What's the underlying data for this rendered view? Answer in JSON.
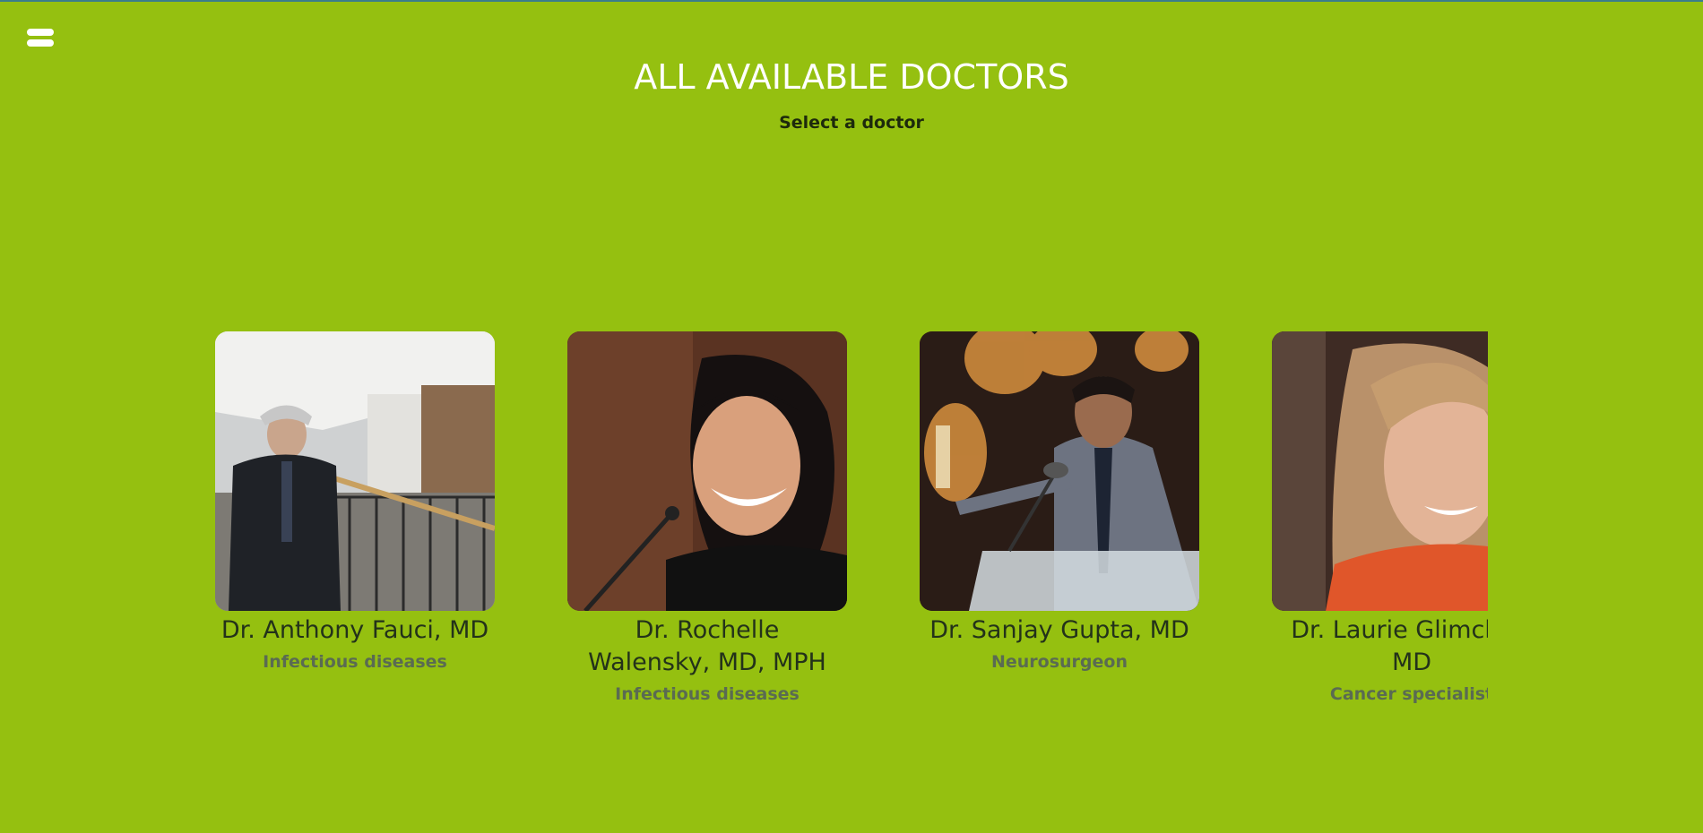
{
  "header": {
    "title": "ALL AVAILABLE DOCTORS",
    "subtitle": "Select a doctor"
  },
  "icons": {
    "menu": "hamburger-menu-icon"
  },
  "colors": {
    "background": "#95c010",
    "title": "#ffffff",
    "specialty": "#5a6b52"
  },
  "doctors": [
    {
      "name": "Dr. Anthony Fauci, MD",
      "specialty": "Infectious diseases",
      "photo": "doctor-photo"
    },
    {
      "name": "Dr. Rochelle Walensky, MD, MPH",
      "specialty": "Infectious diseases",
      "photo": "doctor-photo"
    },
    {
      "name": "Dr. Sanjay Gupta, MD",
      "specialty": "Neurosurgeon",
      "photo": "doctor-photo"
    },
    {
      "name": "Dr. Laurie Glimcher, MD",
      "specialty": "Cancer specialist",
      "photo": "doctor-photo"
    }
  ]
}
